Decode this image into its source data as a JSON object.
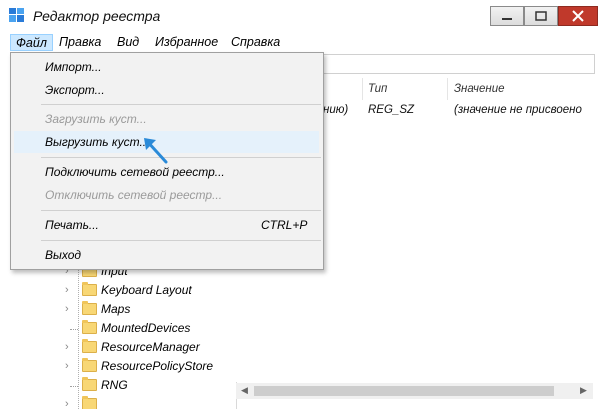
{
  "window": {
    "title": "Редактор реестра"
  },
  "menubar": {
    "items": [
      {
        "label": "Файл"
      },
      {
        "label": "Правка"
      },
      {
        "label": "Вид"
      },
      {
        "label": "Избранное"
      },
      {
        "label": "Справка"
      }
    ]
  },
  "file_menu": {
    "import": "Импорт...",
    "export": "Экспорт...",
    "load_hive": "Загрузить куст...",
    "unload_hive": "Выгрузить куст...",
    "connect_registry": "Подключить сетевой реестр...",
    "disconnect_registry": "Отключить сетевой реестр...",
    "print": "Печать...",
    "print_shortcut": "CTRL+P",
    "exit": "Выход"
  },
  "values_table": {
    "columns": [
      "Тип",
      "Значение"
    ],
    "row": {
      "name_fragment": "нию)",
      "type": "REG_SZ",
      "value": "(значение не присвоено"
    }
  },
  "tree": {
    "items": [
      "Input",
      "Keyboard Layout",
      "Maps",
      "MountedDevices",
      "ResourceManager",
      "ResourcePolicyStore",
      "RNG"
    ]
  },
  "colors": {
    "menu_active": "#cce8ff",
    "folder": "#f8d775",
    "close_button": "#c0392b"
  }
}
